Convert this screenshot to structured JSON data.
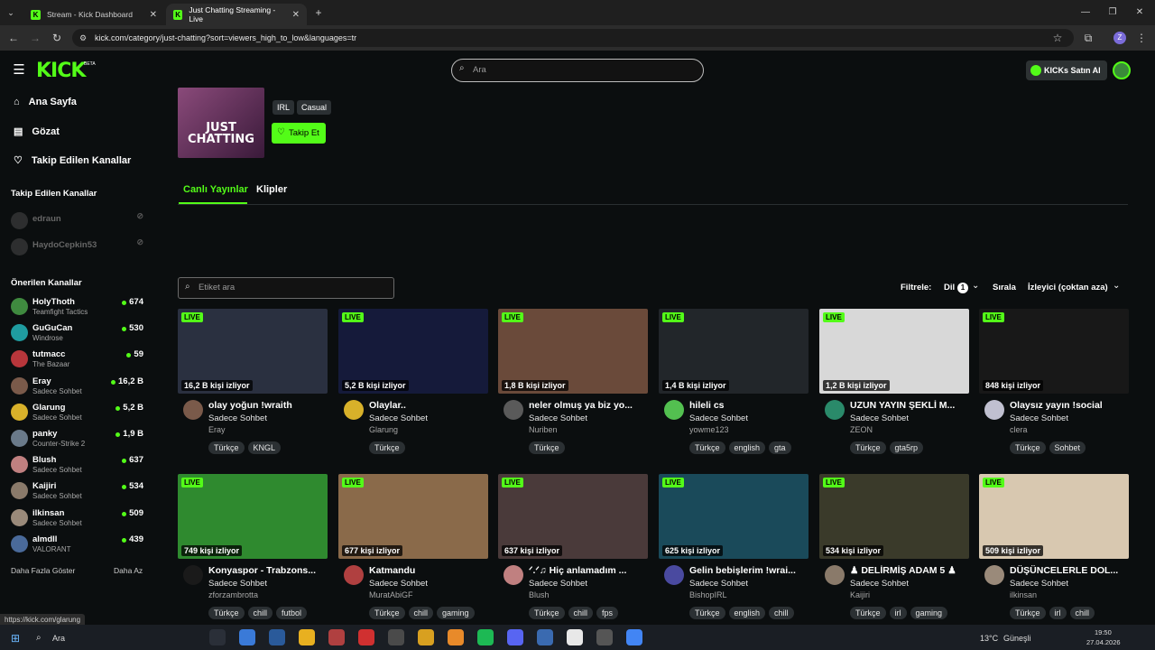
{
  "browser": {
    "tabs": [
      {
        "title": "Stream - Kick Dashboard"
      },
      {
        "title": "Just Chatting Streaming - Live"
      }
    ],
    "url": "kick.com/category/just-chatting?sort=viewers_high_to_low&languages=tr",
    "status_url": "https://kick.com/glarung"
  },
  "header": {
    "logo": "KICK",
    "beta": "BETA",
    "search_placeholder": "Ara",
    "kicks_button": "KICKs Satın Al"
  },
  "nav": [
    {
      "label": "Ana Sayfa",
      "icon": "home-icon"
    },
    {
      "label": "Gözat",
      "icon": "browse-icon"
    },
    {
      "label": "Takip Edilen Kanallar",
      "icon": "heart-icon"
    }
  ],
  "followed": {
    "heading": "Takip Edilen Kanallar",
    "items": [
      {
        "name": "edraun"
      },
      {
        "name": "HaydoCepkin53"
      }
    ]
  },
  "recommended": {
    "heading": "Önerilen Kanallar",
    "items": [
      {
        "name": "HolyThoth",
        "sub": "Teamfight Tactics",
        "viewers": "674",
        "color": "#3f8a3f"
      },
      {
        "name": "GuGuCan",
        "sub": "Windrose",
        "viewers": "530",
        "color": "#1f9ca0"
      },
      {
        "name": "tutmacc",
        "sub": "The Bazaar",
        "viewers": "59",
        "color": "#b8363b"
      },
      {
        "name": "Eray",
        "sub": "Sadece Sohbet",
        "viewers": "16,2 B",
        "color": "#7a5a4a"
      },
      {
        "name": "Glarung",
        "sub": "Sadece Sohbet",
        "viewers": "5,2 B",
        "color": "#d8b12a"
      },
      {
        "name": "panky",
        "sub": "Counter-Strike 2",
        "viewers": "1,9 B",
        "color": "#6a7a8a"
      },
      {
        "name": "Blush",
        "sub": "Sadece Sohbet",
        "viewers": "637",
        "color": "#c08080"
      },
      {
        "name": "Kaijiri",
        "sub": "Sadece Sohbet",
        "viewers": "534",
        "color": "#8a7a6a"
      },
      {
        "name": "ilkinsan",
        "sub": "Sadece Sohbet",
        "viewers": "509",
        "color": "#9a8a7a"
      },
      {
        "name": "almdll",
        "sub": "VALORANT",
        "viewers": "439",
        "color": "#4a6a9a"
      }
    ],
    "show_more": "Daha Fazla Göster",
    "show_less": "Daha Az"
  },
  "category": {
    "image_text": "JUST CHATTING",
    "tags": [
      "IRL",
      "Casual"
    ],
    "follow_button": "Takip Et",
    "tabs": [
      "Canlı Yayınlar",
      "Klipler"
    ]
  },
  "filters": {
    "tag_search_placeholder": "Etiket ara",
    "filter_label": "Filtrele:",
    "language_label": "Dil",
    "language_count": "1",
    "sort_label": "Sırala",
    "sort_value": "İzleyici (çoktan aza)"
  },
  "streams": [
    {
      "live": "LIVE",
      "viewers": "16,2 B kişi izliyor",
      "title": "olay yoğun !wraith",
      "category": "Sadece Sohbet",
      "channel": "Eray",
      "tags": [
        "Türkçe",
        "KNGL"
      ],
      "thumb": "#2a3040",
      "avatar": "#7a5a4a"
    },
    {
      "live": "LIVE",
      "viewers": "5,2 B kişi izliyor",
      "title": "Olaylar..",
      "category": "Sadece Sohbet",
      "channel": "Glarung",
      "tags": [
        "Türkçe"
      ],
      "thumb": "#151a3a",
      "avatar": "#d8b12a"
    },
    {
      "live": "LIVE",
      "viewers": "1,8 B kişi izliyor",
      "title": "neler olmuş ya biz yo...",
      "category": "Sadece Sohbet",
      "channel": "Nuriben",
      "tags": [
        "Türkçe"
      ],
      "thumb": "#6a4a3a",
      "avatar": "#5a5a5a"
    },
    {
      "live": "LIVE",
      "viewers": "1,4 B kişi izliyor",
      "title": "hileli cs",
      "category": "Sadece Sohbet",
      "channel": "yowme123",
      "tags": [
        "Türkçe",
        "english",
        "gta"
      ],
      "thumb": "#22262a",
      "avatar": "#53c050"
    },
    {
      "live": "LIVE",
      "viewers": "1,2 B kişi izliyor",
      "title": "UZUN YAYIN ŞEKLİ M...",
      "category": "Sadece Sohbet",
      "channel": "ZEON",
      "tags": [
        "Türkçe",
        "gta5rp"
      ],
      "thumb": "#d8d8d8",
      "avatar": "#2a8a6a"
    },
    {
      "live": "LIVE",
      "viewers": "848 kişi izliyor",
      "title": "Olaysız yayın !social",
      "category": "Sadece Sohbet",
      "channel": "clera",
      "tags": [
        "Türkçe",
        "Sohbet"
      ],
      "thumb": "#181818",
      "avatar": "#c0c0d0"
    },
    {
      "live": "LIVE",
      "viewers": "749 kişi izliyor",
      "title": "Konyaspor - Trabzons...",
      "category": "Sadece Sohbet",
      "channel": "zforzambrotta",
      "tags": [
        "Türkçe",
        "chill",
        "futbol"
      ],
      "thumb": "#2f8a2f",
      "avatar": "#1a1a1a"
    },
    {
      "live": "LIVE",
      "viewers": "677 kişi izliyor",
      "title": "Katmandu",
      "category": "Sadece Sohbet",
      "channel": "MuratAbiGF",
      "tags": [
        "Türkçe",
        "chill",
        "gaming"
      ],
      "thumb": "#8a6a4a",
      "avatar": "#b04040"
    },
    {
      "live": "LIVE",
      "viewers": "637 kişi izliyor",
      "title": "ᐟ.ᐟ♫ Hiç anlamadım ...",
      "category": "Sadece Sohbet",
      "channel": "Blush",
      "tags": [
        "Türkçe",
        "chill",
        "fps"
      ],
      "thumb": "#4a3a3a",
      "avatar": "#c08080"
    },
    {
      "live": "LIVE",
      "viewers": "625 kişi izliyor",
      "title": "Gelin bebişlerim !wrai...",
      "category": "Sadece Sohbet",
      "channel": "BishopIRL",
      "tags": [
        "Türkçe",
        "english",
        "chill"
      ],
      "thumb": "#1a4a5a",
      "avatar": "#4a4aa0"
    },
    {
      "live": "LIVE",
      "viewers": "534 kişi izliyor",
      "title": "♟ DELİRMİŞ ADAM 5 ♟",
      "category": "Sadece Sohbet",
      "channel": "Kaijiri",
      "tags": [
        "Türkçe",
        "irl",
        "gaming"
      ],
      "thumb": "#3a3a2a",
      "avatar": "#8a7a6a"
    },
    {
      "live": "LIVE",
      "viewers": "509 kişi izliyor",
      "title": "DÜŞÜNCELERLE DOL...",
      "category": "Sadece Sohbet",
      "channel": "ilkinsan",
      "tags": [
        "Türkçe",
        "irl",
        "chill"
      ],
      "thumb": "#d8c8b0",
      "avatar": "#9a8a7a"
    }
  ],
  "taskbar": {
    "search": "Ara",
    "weather": "13°C",
    "weather_text": "Güneşli",
    "time": "19:50",
    "date": "27.04.2026"
  }
}
